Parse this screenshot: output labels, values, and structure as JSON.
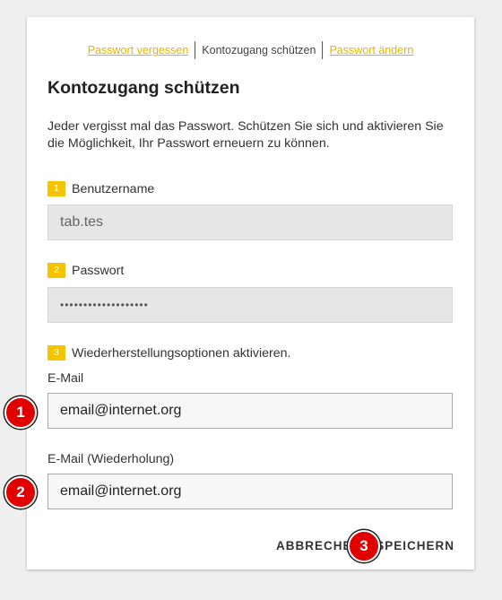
{
  "breadcrumb": {
    "forgot": "Passwort vergessen",
    "current": "Kontozugang schützen",
    "change": "Passwort ändern"
  },
  "title": "Kontozugang schützen",
  "description": "Jeder vergisst mal das Passwort. Schützen Sie sich und aktivieren Sie die Möglichkeit, Ihr Passwort erneuern zu können.",
  "steps": {
    "one": {
      "num": "1",
      "label": "Benutzername",
      "value": "tab.tes"
    },
    "two": {
      "num": "2",
      "label": "Passwort",
      "value": "•••••••••••••••••••"
    },
    "three": {
      "num": "3",
      "label": "Wiederherstellungsoptionen aktivieren."
    }
  },
  "email": {
    "label": "E-Mail",
    "value": "email@internet.org"
  },
  "email_repeat": {
    "label": "E-Mail (Wiederholung)",
    "value": "email@internet.org"
  },
  "actions": {
    "cancel": "ABBRECHEN",
    "save": "SPEICHERN"
  },
  "markers": {
    "m1": "1",
    "m2": "2",
    "m3": "3"
  },
  "colors": {
    "accent": "#f5c400",
    "link": "#e8b400",
    "marker": "#e00000"
  }
}
